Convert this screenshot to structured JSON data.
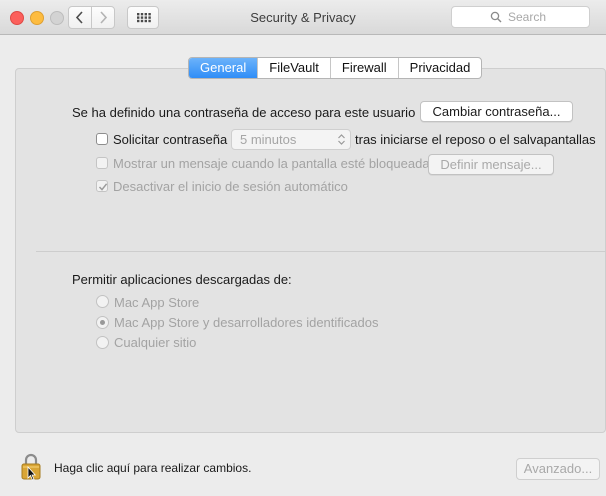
{
  "window": {
    "title": "Security & Privacy"
  },
  "search": {
    "placeholder": "Search"
  },
  "tabs": [
    {
      "label": "General",
      "active": true
    },
    {
      "label": "FileVault",
      "active": false
    },
    {
      "label": "Firewall",
      "active": false
    },
    {
      "label": "Privacidad",
      "active": false
    }
  ],
  "general": {
    "password_text": "Se ha definido una contraseña de acceso para este usuario",
    "change_password_button": "Cambiar contraseña...",
    "require_password": {
      "label": "Solicitar contraseña",
      "checked": false,
      "delay_value": "5 minutos",
      "suffix": "tras iniciarse el reposo o el salvapantallas"
    },
    "show_message": {
      "label": "Mostrar un mensaje cuando la pantalla esté bloqueada",
      "checked": false,
      "enabled": false,
      "button": "Definir mensaje..."
    },
    "disable_auto_login": {
      "label": "Desactivar el inicio de sesión automático",
      "checked": true,
      "enabled": false
    }
  },
  "downloads": {
    "label": "Permitir aplicaciones descargadas de:",
    "options": [
      {
        "label": "Mac App Store",
        "selected": false
      },
      {
        "label": "Mac App Store y desarrolladores identificados",
        "selected": true
      },
      {
        "label": "Cualquier sitio",
        "selected": false
      }
    ]
  },
  "footer": {
    "lock_text": "Haga clic aquí para realizar cambios.",
    "advanced_button": "Avanzado..."
  },
  "colors": {
    "tab_active": "#3b93f7",
    "close": "#fc605c",
    "minimize": "#fdbc40"
  }
}
